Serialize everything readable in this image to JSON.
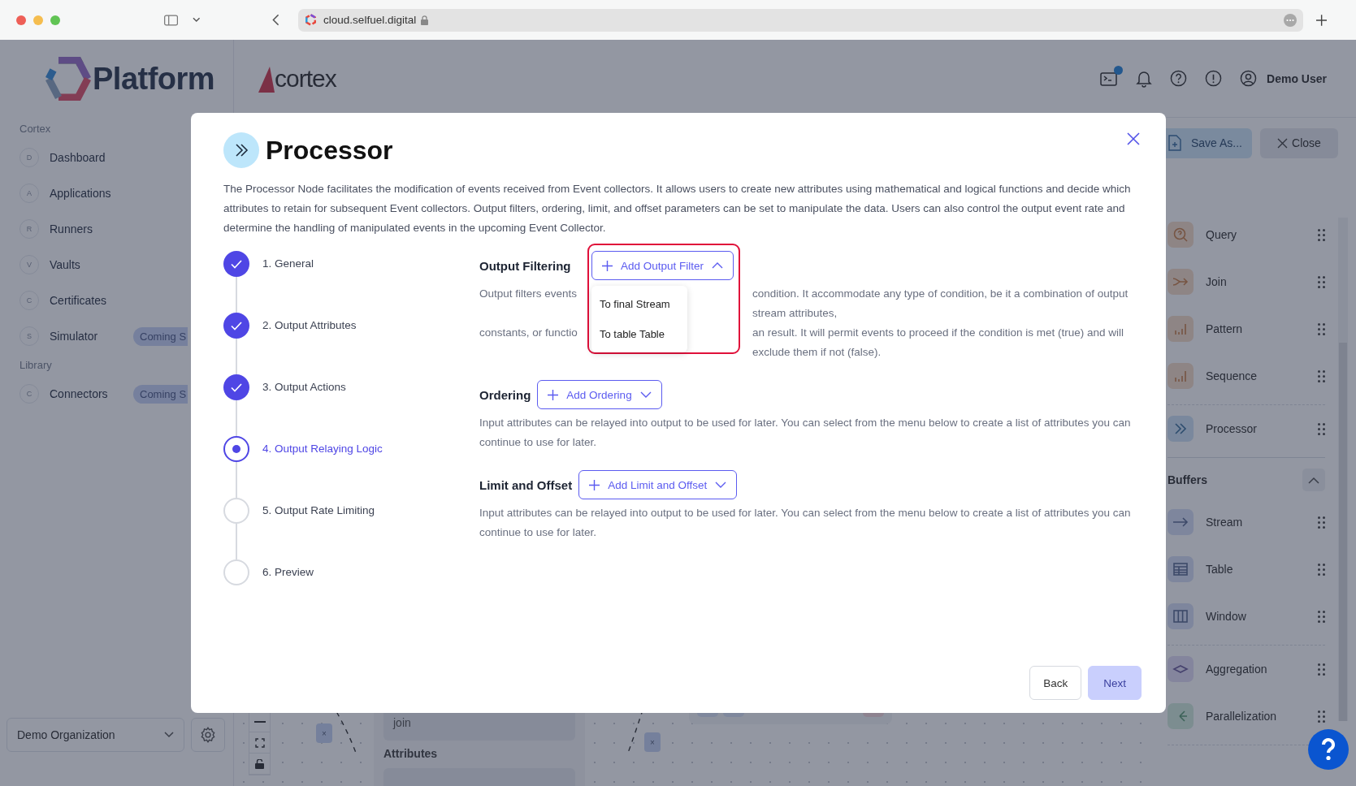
{
  "browser": {
    "url": "cloud.selfuel.digital"
  },
  "app": {
    "logo": "Platform",
    "product": "cortex",
    "user": "Demo User",
    "terminal_badge": true
  },
  "sidebar": {
    "sections": [
      {
        "title": "Cortex",
        "items": [
          {
            "letter": "D",
            "label": "Dashboard"
          },
          {
            "letter": "A",
            "label": "Applications"
          },
          {
            "letter": "R",
            "label": "Runners"
          },
          {
            "letter": "V",
            "label": "Vaults"
          },
          {
            "letter": "C",
            "label": "Certificates"
          },
          {
            "letter": "S",
            "label": "Simulator",
            "badge": "Coming S"
          }
        ]
      },
      {
        "title": "Library",
        "items": [
          {
            "letter": "C",
            "label": "Connectors",
            "badge": "Coming S"
          }
        ]
      }
    ],
    "organization": "Demo Organization"
  },
  "toolbar": {
    "save_button": "Save As...",
    "close_button": "Close"
  },
  "palette": {
    "groups": [
      {
        "items": [
          {
            "kind": "query",
            "label": "Query"
          },
          {
            "kind": "join",
            "label": "Join"
          },
          {
            "kind": "pattern",
            "label": "Pattern"
          },
          {
            "kind": "sequence",
            "label": "Sequence"
          }
        ]
      },
      {
        "items": [
          {
            "kind": "processor",
            "label": "Processor"
          }
        ]
      },
      {
        "title": "Buffers",
        "expanded": true,
        "items": [
          {
            "kind": "stream",
            "label": "Stream"
          },
          {
            "kind": "table",
            "label": "Table"
          },
          {
            "kind": "window",
            "label": "Window"
          }
        ]
      },
      {
        "items": [
          {
            "kind": "aggregation",
            "label": "Aggregation"
          },
          {
            "kind": "parallelization",
            "label": "Parallelization"
          }
        ]
      }
    ]
  },
  "canvas": {
    "node_field": "join",
    "attributes_label": "Attributes",
    "edge_buttons": [
      "×",
      "×"
    ]
  },
  "modal": {
    "title": "Processor",
    "description": "The Processor Node facilitates the modification of events received from Event collectors. It allows users to create new attributes using mathematical and logical functions and decide which attributes to retain for subsequent Event collectors. Output filters, ordering, limit, and offset parameters can be set to manipulate the data. Users can also control the output event rate and determine the handling of manipulated events in the upcoming Event Collector.",
    "steps": [
      {
        "label": "1. General",
        "completed": true,
        "selected": false
      },
      {
        "label": "2. Output Attributes",
        "completed": true,
        "selected": false
      },
      {
        "label": "3. Output Actions",
        "completed": true,
        "selected": false
      },
      {
        "label": "4. Output Relaying Logic",
        "completed": false,
        "selected": true
      },
      {
        "label": "5. Output Rate Limiting",
        "completed": false,
        "selected": false
      },
      {
        "label": "6. Preview",
        "completed": false,
        "selected": false
      }
    ],
    "sections": [
      {
        "title": "Output Filtering",
        "button": "Add Output Filter",
        "expanded": true,
        "highlighted": true,
        "menu": [
          "To final Stream",
          "To table Table"
        ],
        "description_parts": [
          "Output filters events",
          "condition. It accommodate any type of condition, be it a combination of output stream attributes,",
          "constants, or functio",
          "an result. It will permit events to proceed if the condition is met (true) and will exclude them if not (false)."
        ]
      },
      {
        "title": "Ordering",
        "button": "Add Ordering",
        "expanded": false,
        "highlighted": false,
        "description": "Input attributes can be relayed into output to be used for later. You can select from the menu below to create a list of attributes you can continue to use for later."
      },
      {
        "title": "Limit and Offset",
        "button": "Add Limit and Offset",
        "expanded": false,
        "highlighted": false,
        "description": "Input attributes can be relayed into output to be used for later. You can select from the menu below to create a list of attributes you can continue to use for later."
      }
    ],
    "buttons": [
      {
        "label": "Back",
        "primary": false
      },
      {
        "label": "Next",
        "primary": true
      }
    ]
  }
}
